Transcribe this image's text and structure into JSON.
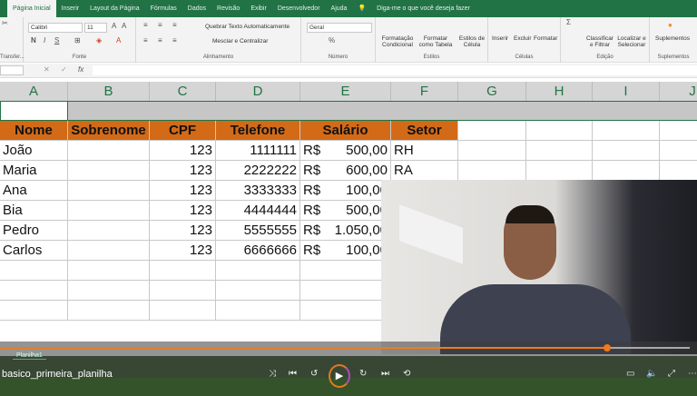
{
  "ribbon": {
    "tabs": [
      "Página Inicial",
      "Inserir",
      "Layout da Página",
      "Fórmulas",
      "Dados",
      "Revisão",
      "Exibir",
      "Desenvolvedor",
      "Ajuda"
    ],
    "tell_me": "Diga-me o que você deseja fazer",
    "font_name": "Calibri",
    "font_size": "11",
    "wrap_text": "Quebrar Texto Automaticamente",
    "merge_center": "Mesclar e Centralizar",
    "number_format": "Geral",
    "groups": {
      "clipboard": "Transfer...",
      "font": "Fonte",
      "alignment": "Alinhamento",
      "number": "Número",
      "styles": "Estilos",
      "cells": "Células",
      "editing": "Edição",
      "addins": "Suplementos"
    },
    "buttons": {
      "cond_format": "Formatação Condicional",
      "format_table": "Formatar como Tabela",
      "cell_styles": "Estilos de Célula",
      "insert": "Inserir",
      "delete": "Excluir",
      "format": "Formatar",
      "sort_filter": "Classificar e Filtrar",
      "find_select": "Localizar e Selecionar",
      "addins": "Suplementos"
    }
  },
  "formula_bar": {
    "fx": "fx"
  },
  "columns": [
    "A",
    "B",
    "C",
    "D",
    "E",
    "F",
    "G",
    "H",
    "I",
    "J"
  ],
  "table": {
    "headers": [
      "Nome",
      "Sobrenome",
      "CPF",
      "Telefone",
      "Salário",
      "Setor"
    ],
    "rows": [
      [
        "João",
        "",
        "123",
        "1111111",
        "R$",
        "500,00",
        "RH"
      ],
      [
        "Maria",
        "",
        "123",
        "2222222",
        "R$",
        "600,00",
        "RA"
      ],
      [
        "Ana",
        "",
        "123",
        "3333333",
        "R$",
        "100,00",
        ""
      ],
      [
        "Bia",
        "",
        "123",
        "4444444",
        "R$",
        "500,00",
        ""
      ],
      [
        "Pedro",
        "",
        "123",
        "5555555",
        "R$",
        "1.050,00",
        ""
      ],
      [
        "Carlos",
        "",
        "123",
        "6666666",
        "R$",
        "100,00",
        ""
      ]
    ]
  },
  "sheet_tab": "Planilha1",
  "player": {
    "title": "basico_primeira_planilha",
    "progress_percent": 88,
    "accent": "#f07a1a"
  }
}
